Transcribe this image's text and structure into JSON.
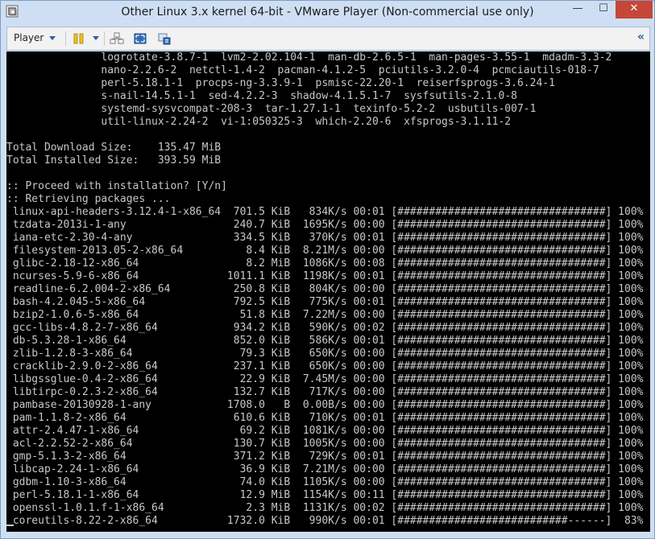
{
  "window": {
    "title": "Other Linux 3.x kernel 64-bit - VMware Player (Non-commercial use only)",
    "controls": {
      "minimize": "—",
      "maximize": "☐",
      "close": "✕"
    }
  },
  "toolbar": {
    "player_label": "Player",
    "collapse_glyph": "«"
  },
  "terminal": {
    "lines": [
      "               logrotate-3.8.7-1  lvm2-2.02.104-1  man-db-2.6.5-1  man-pages-3.55-1  mdadm-3.3-2",
      "               nano-2.2.6-2  netctl-1.4-2  pacman-4.1.2-5  pciutils-3.2.0-4  pcmciautils-018-7",
      "               perl-5.18.1-1  procps-ng-3.3.9-1  psmisc-22.20-1  reiserfsprogs-3.6.24-1",
      "               s-nail-14.5.1-1  sed-4.2.2-3  shadow-4.1.5.1-7  sysfsutils-2.1.0-8",
      "               systemd-sysvcompat-208-3  tar-1.27.1-1  texinfo-5.2-2  usbutils-007-1",
      "               util-linux-2.24-2  vi-1:050325-3  which-2.20-6  xfsprogs-3.1.11-2",
      "",
      "Total Download Size:    135.47 MiB",
      "Total Installed Size:   393.59 MiB",
      "",
      ":: Proceed with installation? [Y/n]",
      ":: Retrieving packages ...",
      " linux-api-headers-3.12.4-1-x86_64  701.5 KiB   834K/s 00:01 [#################################] 100%",
      " tzdata-2013i-1-any                 240.7 KiB  1695K/s 00:00 [#################################] 100%",
      " iana-etc-2.30-4-any                334.5 KiB   370K/s 00:01 [#################################] 100%",
      " filesystem-2013.05-2-x86_64          8.4 KiB  8.21M/s 00:00 [#################################] 100%",
      " glibc-2.18-12-x86_64                 8.2 MiB  1086K/s 00:08 [#################################] 100%",
      " ncurses-5.9-6-x86_64              1011.1 KiB  1198K/s 00:01 [#################################] 100%",
      " readline-6.2.004-2-x86_64          250.8 KiB   804K/s 00:00 [#################################] 100%",
      " bash-4.2.045-5-x86_64              792.5 KiB   775K/s 00:01 [#################################] 100%",
      " bzip2-1.0.6-5-x86_64                51.8 KiB  7.22M/s 00:00 [#################################] 100%",
      " gcc-libs-4.8.2-7-x86_64            934.2 KiB   590K/s 00:02 [#################################] 100%",
      " db-5.3.28-1-x86_64                 852.0 KiB   586K/s 00:01 [#################################] 100%",
      " zlib-1.2.8-3-x86_64                 79.3 KiB   650K/s 00:00 [#################################] 100%",
      " cracklib-2.9.0-2-x86_64            237.1 KiB   650K/s 00:00 [#################################] 100%",
      " libgssglue-0.4-2-x86_64             22.9 KiB  7.45M/s 00:00 [#################################] 100%",
      " libtirpc-0.2.3-2-x86_64            132.7 KiB   717K/s 00:00 [#################################] 100%",
      " pambase-20130928-1-any            1708.0   B  0.00B/s 00:00 [#################################] 100%",
      " pam-1.1.8-2-x86_64                 610.6 KiB   710K/s 00:01 [#################################] 100%",
      " attr-2.4.47-1-x86_64                69.2 KiB  1081K/s 00:00 [#################################] 100%",
      " acl-2.2.52-2-x86_64                130.7 KiB  1005K/s 00:00 [#################################] 100%",
      " gmp-5.1.3-2-x86_64                 371.2 KiB   729K/s 00:01 [#################################] 100%",
      " libcap-2.24-1-x86_64                36.9 KiB  7.21M/s 00:00 [#################################] 100%",
      " gdbm-1.10-3-x86_64                  74.0 KiB  1105K/s 00:00 [#################################] 100%",
      " perl-5.18.1-1-x86_64                12.9 MiB  1154K/s 00:11 [#################################] 100%",
      " openssl-1.0.1.f-1-x86_64             2.3 MiB  1131K/s 00:02 [#################################] 100%",
      " coreutils-8.22-2-x86_64           1732.0 KiB   990K/s 00:01 [###########################------]  83%"
    ]
  }
}
